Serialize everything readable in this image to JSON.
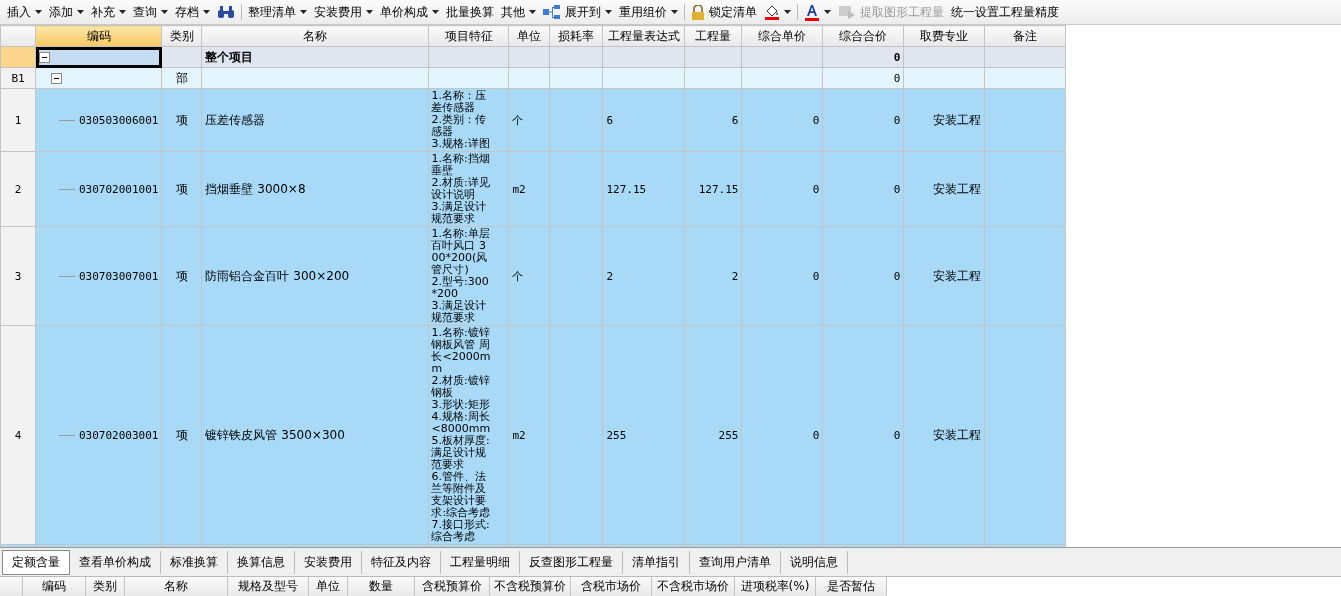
{
  "toolbar": [
    {
      "kind": "menu",
      "label": "插入"
    },
    {
      "kind": "menu",
      "label": "添加"
    },
    {
      "kind": "menu",
      "label": "补充"
    },
    {
      "kind": "menu",
      "label": "查询"
    },
    {
      "kind": "menu",
      "label": "存档"
    },
    {
      "kind": "find"
    },
    {
      "kind": "separator"
    },
    {
      "kind": "menu",
      "label": "整理清单"
    },
    {
      "kind": "menu",
      "label": "安装费用"
    },
    {
      "kind": "menu",
      "label": "单价构成"
    },
    {
      "kind": "button",
      "label": "批量换算"
    },
    {
      "kind": "menu",
      "label": "其他"
    },
    {
      "kind": "tree-menu",
      "label": "展开到"
    },
    {
      "kind": "menu",
      "label": "重用组价"
    },
    {
      "kind": "separator"
    },
    {
      "kind": "lock-button",
      "label": "锁定清单"
    },
    {
      "kind": "fill"
    },
    {
      "kind": "separator"
    },
    {
      "kind": "font-color"
    },
    {
      "kind": "extract-button",
      "label": "提取图形工程量",
      "disabled": true
    },
    {
      "kind": "button",
      "label": "统一设置工程量精度"
    }
  ],
  "grid": {
    "columns": [
      "编码",
      "类别",
      "名称",
      "项目特征",
      "单位",
      "损耗率",
      "工程量表达式",
      "工程量",
      "综合单价",
      "综合合价",
      "取费专业",
      "备注"
    ],
    "rows": [
      {
        "kind": "root",
        "row_header": "",
        "selected": true,
        "expanded": true,
        "code": "",
        "type": "",
        "name": "整个项目",
        "features": [],
        "unit": "",
        "loss": "",
        "expr": "",
        "qty": "",
        "unit_price": "",
        "total": "0",
        "fee": "",
        "note": ""
      },
      {
        "kind": "section",
        "row_header": "B1",
        "selected": false,
        "expanded": true,
        "code": "",
        "type": "部",
        "name": "",
        "features": [],
        "unit": "",
        "loss": "",
        "expr": "",
        "qty": "",
        "unit_price": "",
        "total": "0",
        "fee": "",
        "note": ""
      },
      {
        "kind": "item",
        "row_header": "1",
        "selected": false,
        "code": "030503006001",
        "type": "项",
        "name": "压差传感器",
        "features": [
          "1.名称：压差传感器",
          "2.类别：传感器",
          "3.规格:详图"
        ],
        "unit": "个",
        "loss": "",
        "expr": "6",
        "qty": "6",
        "unit_price": "0",
        "total": "0",
        "fee": "安装工程",
        "note": ""
      },
      {
        "kind": "item",
        "row_header": "2",
        "selected": false,
        "code": "030702001001",
        "type": "项",
        "name": "挡烟垂壁 3000×8",
        "features": [
          "1.名称:挡烟垂壁",
          "2.材质:详见设计说明",
          "3.满足设计规范要求"
        ],
        "unit": "m2",
        "loss": "",
        "expr": "127.15",
        "qty": "127.15",
        "unit_price": "0",
        "total": "0",
        "fee": "安装工程",
        "note": ""
      },
      {
        "kind": "item",
        "row_header": "3",
        "selected": false,
        "code": "030703007001",
        "type": "项",
        "name": "防雨铝合金百叶 300×200",
        "features": [
          "1.名称:单层百叶风口 300*200(风管尺寸)",
          "2.型号:300*200",
          "3.满足设计规范要求"
        ],
        "unit": "个",
        "loss": "",
        "expr": "2",
        "qty": "2",
        "unit_price": "0",
        "total": "0",
        "fee": "安装工程",
        "note": ""
      },
      {
        "kind": "item",
        "row_header": "4",
        "selected": false,
        "code": "030702003001",
        "type": "项",
        "name": "镀锌铁皮风管 3500×300",
        "features": [
          "1.名称:镀锌钢板风管 周长<2000mm",
          "2.材质:镀锌钢板",
          "3.形状:矩形",
          "4.规格:周长<8000mm",
          "5.板材厚度:满足设计规范要求",
          "6.管件、法兰等附件及支架设计要求:综合考虑",
          "7.接口形式:综合考虑"
        ],
        "unit": "m2",
        "loss": "",
        "expr": "255",
        "qty": "255",
        "unit_price": "0",
        "total": "0",
        "fee": "安装工程",
        "note": ""
      }
    ]
  },
  "bottom_tabs": [
    {
      "label": "定额含量",
      "selected": true
    },
    {
      "label": "查看单价构成",
      "selected": false
    },
    {
      "label": "标准换算",
      "selected": false
    },
    {
      "label": "换算信息",
      "selected": false
    },
    {
      "label": "安装费用",
      "selected": false
    },
    {
      "label": "特征及内容",
      "selected": false
    },
    {
      "label": "工程量明细",
      "selected": false
    },
    {
      "label": "反查图形工程量",
      "selected": false
    },
    {
      "label": "清单指引",
      "selected": false
    },
    {
      "label": "查询用户清单",
      "selected": false
    },
    {
      "label": "说明信息",
      "selected": false
    }
  ],
  "detail_columns": [
    "编码",
    "类别",
    "名称",
    "规格及型号",
    "单位",
    "数量",
    "含税预算价",
    "不含税预算价",
    "含税市场价",
    "不含税市场价",
    "进项税率(%)",
    "是否暂估"
  ]
}
